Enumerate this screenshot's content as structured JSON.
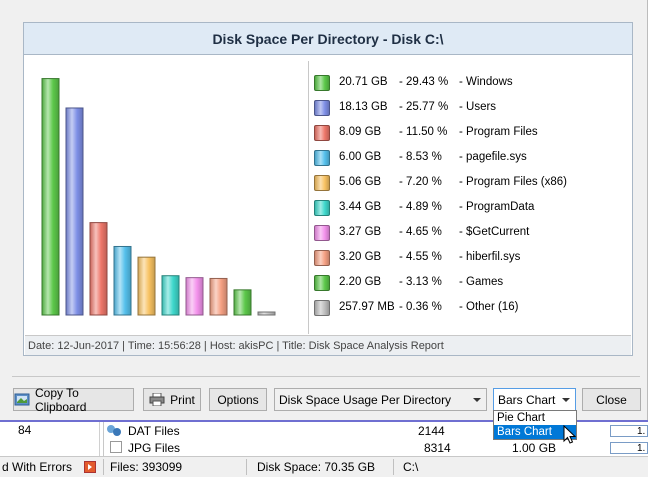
{
  "report": {
    "title": "Disk Space Per Directory - Disk C:\\",
    "footer": "Date: 12-Jun-2017 | Time: 15:56:28 | Host: akisPC | Title: Disk Space Analysis Report"
  },
  "chart_data": {
    "type": "bar",
    "categories": [
      "Windows",
      "Users",
      "Program Files",
      "pagefile.sys",
      "Program Files (x86)",
      "ProgramData",
      "$GetCurrent",
      "hiberfil.sys",
      "Games",
      "Other (16)"
    ],
    "values": [
      29.43,
      25.77,
      11.5,
      8.53,
      7.2,
      4.89,
      4.65,
      4.55,
      3.13,
      0.36
    ],
    "ylim": [
      0,
      30
    ],
    "legend": [
      {
        "size": "20.71 GB",
        "percent": "- 29.43 %",
        "name": "- Windows",
        "color": "#5cc84a"
      },
      {
        "size": "18.13 GB",
        "percent": "- 25.77 %",
        "name": "- Users",
        "color": "#7e8fe6"
      },
      {
        "size": "8.09 GB",
        "percent": "- 11.50 %",
        "name": "- Program Files",
        "color": "#ee776a"
      },
      {
        "size": "6.00 GB",
        "percent": "- 8.53 %",
        "name": "- pagefile.sys",
        "color": "#55c0ec"
      },
      {
        "size": "5.06 GB",
        "percent": "- 7.20 %",
        "name": "- Program Files (x86)",
        "color": "#f8c262"
      },
      {
        "size": "3.44 GB",
        "percent": "- 4.89 %",
        "name": "- ProgramData",
        "color": "#3ed8cc"
      },
      {
        "size": "3.27 GB",
        "percent": "- 4.65 %",
        "name": "- $GetCurrent",
        "color": "#f392ec"
      },
      {
        "size": "3.20 GB",
        "percent": "- 4.55 %",
        "name": "- hiberfil.sys",
        "color": "#f5a083"
      },
      {
        "size": "2.20 GB",
        "percent": "- 3.13 %",
        "name": "- Games",
        "color": "#5cc84a"
      },
      {
        "size": "257.97 MB",
        "percent": "- 0.36 %",
        "name": "- Other (16)",
        "color": "#bdbdbd"
      }
    ]
  },
  "toolbar": {
    "copy_label": "Copy To Clipboard",
    "print_label": "Print",
    "options_label": "Options",
    "report_type": "Disk Space Usage Per Directory",
    "chart_type": "Bars Chart",
    "chart_options": [
      "Pie Chart",
      "Bars Chart"
    ],
    "close_label": "Close"
  },
  "underlying": {
    "left_value": "84",
    "rows": [
      {
        "name": "DAT Files",
        "count": "2144",
        "size": "",
        "extra": "1."
      },
      {
        "name": "JPG Files",
        "count": "8314",
        "size": "1.00 GB",
        "extra": "1."
      }
    ]
  },
  "statusbar": {
    "errors": "d With Errors",
    "files": "Files: 393099",
    "disk_space": "Disk Space: 70.35 GB",
    "path": "C:\\"
  }
}
